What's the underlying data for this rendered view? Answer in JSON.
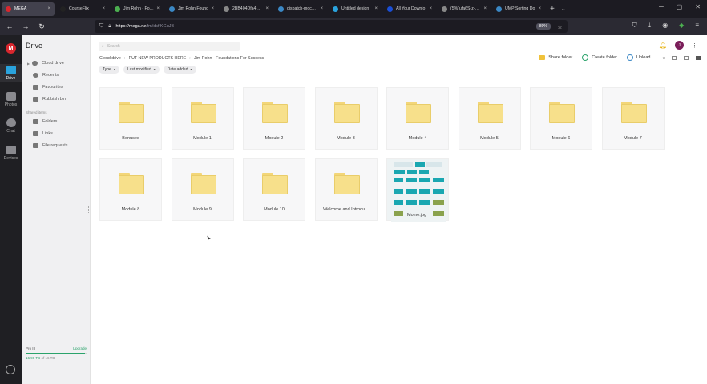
{
  "browser": {
    "tabs": [
      {
        "title": "MEGA",
        "color": "#d9272e",
        "active": true
      },
      {
        "title": "CourseFlix",
        "color": "#222222",
        "active": false
      },
      {
        "title": "Jim Rohn - Founc",
        "color": "#4caf50",
        "active": false
      },
      {
        "title": "Jim Rohn Founc",
        "color": "#3b88c5",
        "active": false
      },
      {
        "title": "2BB404Dfa4m61YeG",
        "color": "#888888",
        "active": false
      },
      {
        "title": "dispatch-mockup",
        "color": "#3b88c5",
        "active": false
      },
      {
        "title": "Untitled design",
        "color": "#2aa3dd",
        "active": false
      },
      {
        "title": "All Your Downlo",
        "color": "#1a4fd6",
        "active": false
      },
      {
        "title": "(5%)ufa6S-z-0-y-tk",
        "color": "#888888",
        "active": false
      },
      {
        "title": "UMP Sorting Do",
        "color": "#3b88c5",
        "active": false
      }
    ],
    "tab_close": "×",
    "new_tab": "+",
    "url_host": "https://mega.nz",
    "url_path": "/fm/dsflKGuJB",
    "zoom": "80%"
  },
  "rail": {
    "logo": "M",
    "items": [
      {
        "label": "Drive",
        "active": true
      },
      {
        "label": "Photos",
        "active": false
      },
      {
        "label": "Chat",
        "active": false
      },
      {
        "label": "Devices",
        "active": false
      }
    ]
  },
  "sidebar": {
    "title": "Drive",
    "items": [
      {
        "label": "Cloud drive",
        "icon": "cloud-icon"
      },
      {
        "label": "Recents",
        "icon": "clock-icon"
      },
      {
        "label": "Favourites",
        "icon": "heart-icon"
      },
      {
        "label": "Rubbish bin",
        "icon": "trash-icon"
      }
    ],
    "section": "Shared items",
    "shared": [
      {
        "label": "Folders",
        "icon": "shared-folder-icon"
      },
      {
        "label": "Links",
        "icon": "link-icon"
      },
      {
        "label": "File requests",
        "icon": "file-request-icon"
      }
    ],
    "plan": {
      "name": "Pro III",
      "upgrade": "Upgrade",
      "used": "16.90 TB",
      "of": "of 16 TB",
      "fraction": 0.97
    }
  },
  "main": {
    "search_placeholder": "Search",
    "breadcrumb": [
      "Cloud drive",
      "PUT NEW PRODUCTS HERE",
      "Jim Rohn - Foundations For Success"
    ],
    "actions": {
      "share": "Share folder",
      "create": "Create folder",
      "upload": "Upload..."
    },
    "filters": [
      "Type",
      "Last modified",
      "Date added"
    ],
    "items": [
      {
        "name": "Bonuses",
        "kind": "folder"
      },
      {
        "name": "Module 1",
        "kind": "folder"
      },
      {
        "name": "Module 2",
        "kind": "folder"
      },
      {
        "name": "Module 3",
        "kind": "folder"
      },
      {
        "name": "Module 4",
        "kind": "folder"
      },
      {
        "name": "Module 5",
        "kind": "folder"
      },
      {
        "name": "Module 6",
        "kind": "folder"
      },
      {
        "name": "Module 7",
        "kind": "folder"
      },
      {
        "name": "Module 8",
        "kind": "folder"
      },
      {
        "name": "Module 9",
        "kind": "folder"
      },
      {
        "name": "Module 10",
        "kind": "folder"
      },
      {
        "name": "Welcome and Introdu...",
        "kind": "folder"
      },
      {
        "name": "Mome.jpg",
        "kind": "image"
      }
    ]
  }
}
